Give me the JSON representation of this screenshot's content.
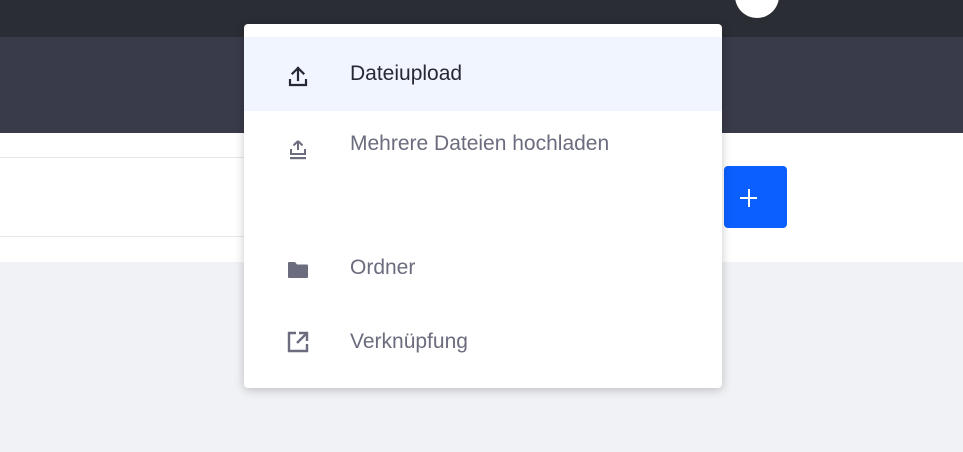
{
  "add_button": {
    "icon": "plus-icon",
    "color": "#0b5fff"
  },
  "menu": {
    "items": [
      {
        "label": "Dateiupload",
        "icon": "upload-icon",
        "active": true
      },
      {
        "label": "Mehrere Dateien hochladen",
        "icon": "multiple-upload-icon",
        "active": false
      },
      {
        "label": "Ordner",
        "icon": "folder-icon",
        "active": false
      },
      {
        "label": "Verknüpfung",
        "icon": "external-link-icon",
        "active": false
      }
    ]
  },
  "colors": {
    "topbar": "#2b2d35",
    "header": "#393a4a",
    "accent": "#0b5fff",
    "active_item_bg": "#f0f5ff",
    "content_bg": "#f1f2f5"
  }
}
